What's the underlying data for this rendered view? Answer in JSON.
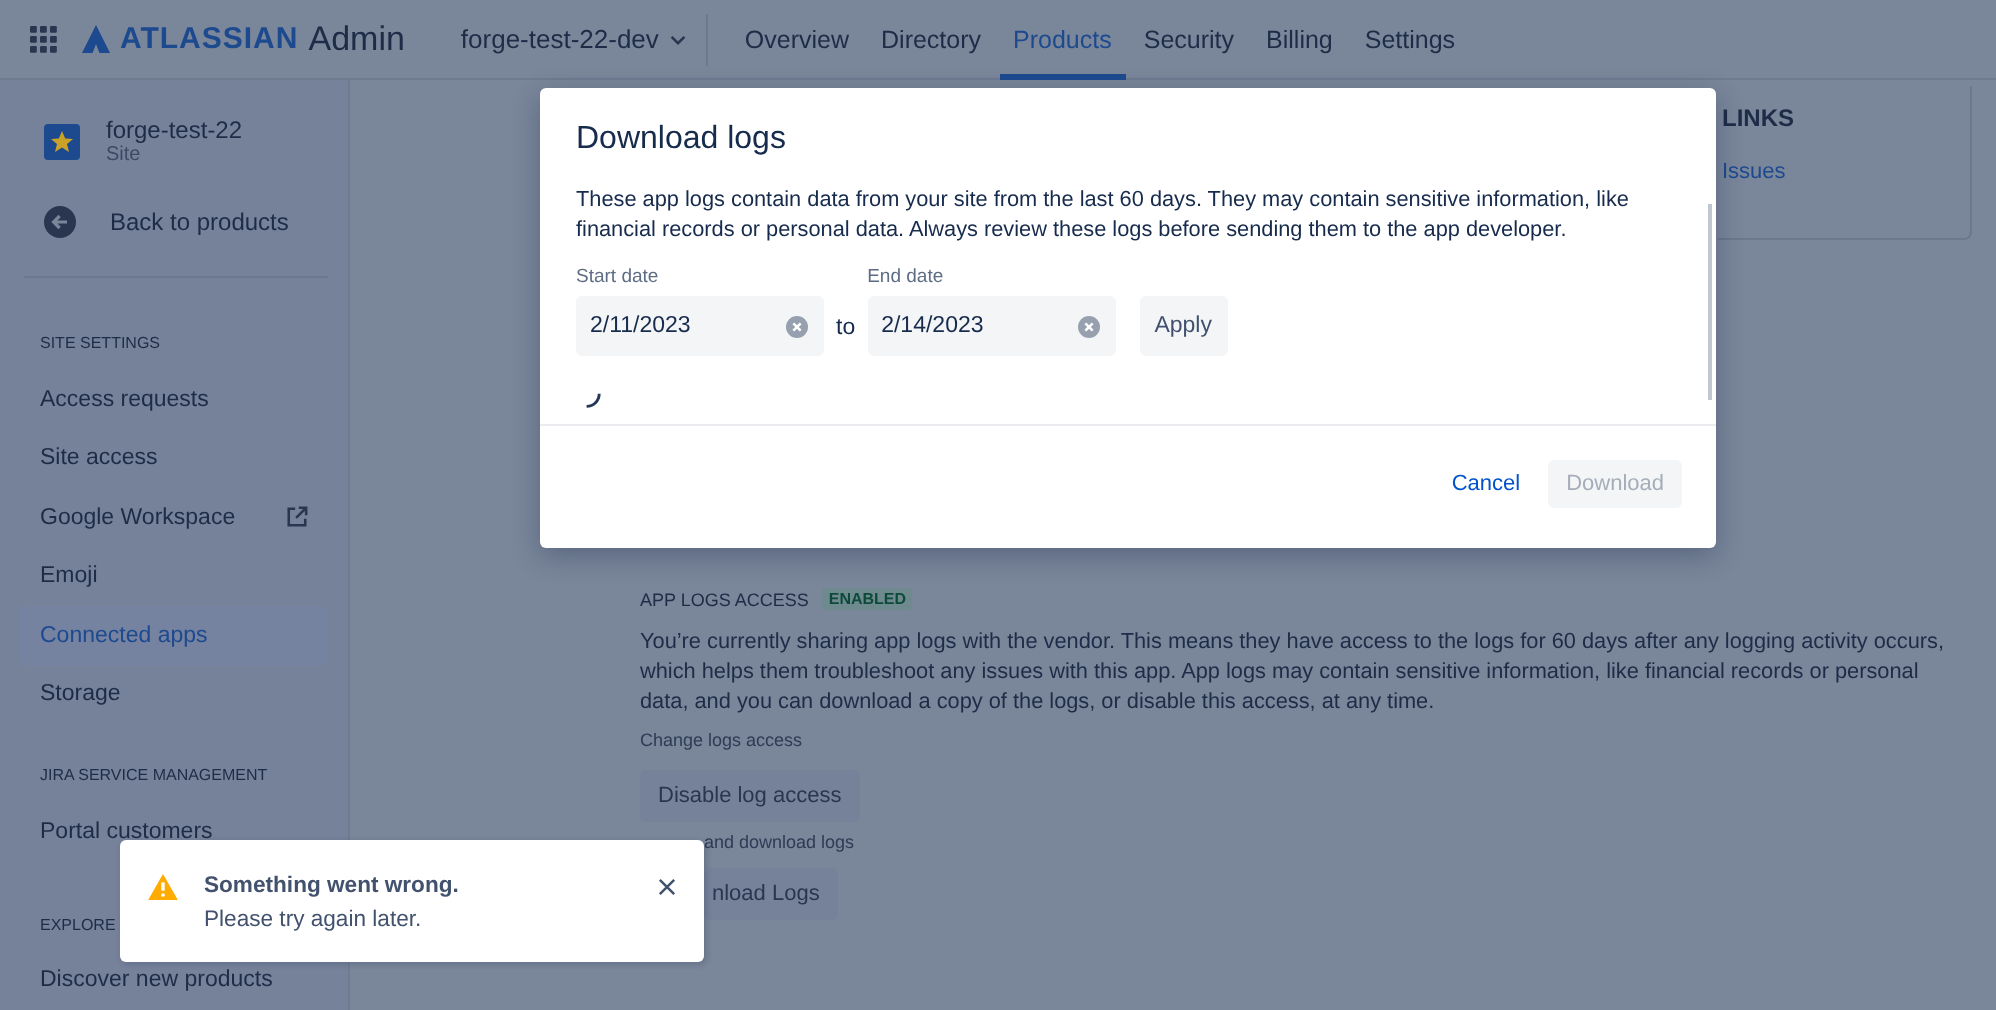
{
  "topbar": {
    "brand": "ATLASSIAN",
    "app": "Admin",
    "org": "forge-test-22-dev",
    "nav": [
      {
        "label": "Overview",
        "selected": false
      },
      {
        "label": "Directory",
        "selected": false
      },
      {
        "label": "Products",
        "selected": true
      },
      {
        "label": "Security",
        "selected": false
      },
      {
        "label": "Billing",
        "selected": false
      },
      {
        "label": "Settings",
        "selected": false
      }
    ]
  },
  "sidebar": {
    "site": {
      "name": "forge-test-22",
      "type": "Site"
    },
    "back": "Back to products",
    "sections": [
      {
        "heading": "SITE SETTINGS",
        "items": [
          {
            "label": "Access requests",
            "selected": false,
            "external": false
          },
          {
            "label": "Site access",
            "selected": false,
            "external": false
          },
          {
            "label": "Google Workspace",
            "selected": false,
            "external": true
          },
          {
            "label": "Emoji",
            "selected": false,
            "external": false
          },
          {
            "label": "Connected apps",
            "selected": true,
            "external": false
          },
          {
            "label": "Storage",
            "selected": false,
            "external": false
          }
        ]
      },
      {
        "heading": "JIRA SERVICE MANAGEMENT",
        "items": [
          {
            "label": "Portal customers",
            "selected": false,
            "external": false
          }
        ]
      },
      {
        "heading": "EXPLORE",
        "items": [
          {
            "label": "Discover new products",
            "selected": false,
            "external": false
          }
        ]
      }
    ]
  },
  "links_card": {
    "heading": "LINKS",
    "link": "Issues"
  },
  "logs_access": {
    "heading": "APP LOGS ACCESS",
    "status": "ENABLED",
    "description": "You’re currently sharing app logs with the vendor. This means they have access to the logs for 60 days after any logging activity occurs, which helps them troubleshoot any issues with this app. App logs may contain sensitive information, like financial records or personal data, and you can download a copy of the logs, or disable this access, at any time.",
    "change_link": "Change logs access",
    "disable_button": "Disable log access",
    "download_caption": "and download logs",
    "download_button": "nload Logs"
  },
  "modal": {
    "title": "Download logs",
    "text": "These app logs contain data from your site from the last 60 days. They may contain sensitive information, like financial records or personal data. Always review these logs before sending them to the app developer.",
    "start_label": "Start date",
    "start_value": "2/11/2023",
    "separator": "to",
    "end_label": "End date",
    "end_value": "2/14/2023",
    "apply": "Apply",
    "loading": true,
    "cancel": "Cancel",
    "download": {
      "label": "Download",
      "disabled": true
    }
  },
  "toast": {
    "kind": "warning",
    "title": "Something went wrong.",
    "message": "Please try again later."
  }
}
